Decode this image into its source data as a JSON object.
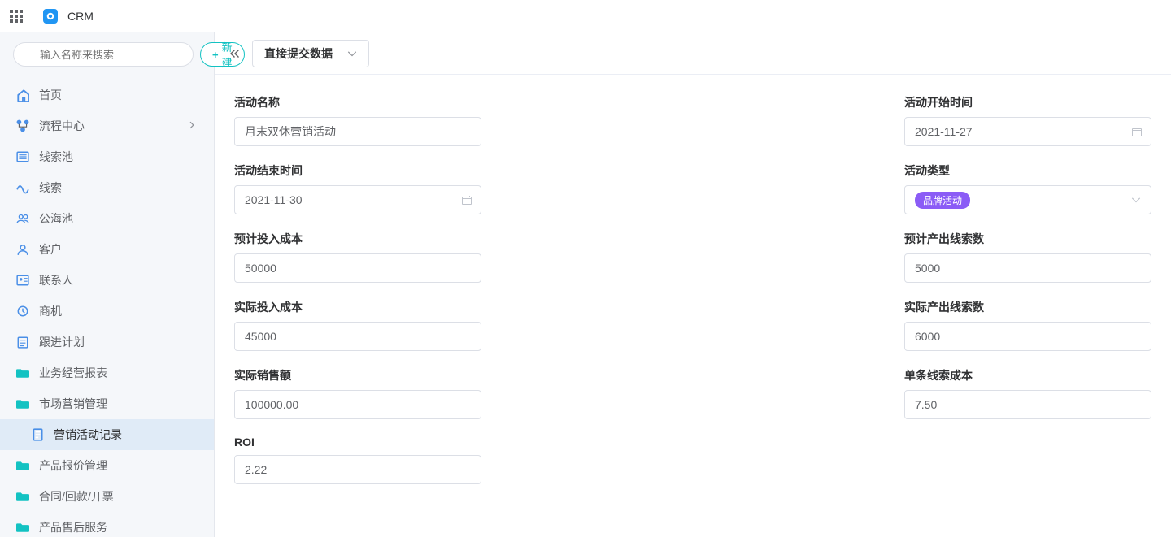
{
  "header": {
    "app_title": "CRM"
  },
  "sidebar": {
    "search_placeholder": "输入名称来搜索",
    "new_button": "新建",
    "items": [
      {
        "label": "首页",
        "icon": "home"
      },
      {
        "label": "流程中心",
        "icon": "flow",
        "has_chevron": true
      },
      {
        "label": "线索池",
        "icon": "pool"
      },
      {
        "label": "线索",
        "icon": "lead"
      },
      {
        "label": "公海池",
        "icon": "public-pool"
      },
      {
        "label": "客户",
        "icon": "customer"
      },
      {
        "label": "联系人",
        "icon": "contact"
      },
      {
        "label": "商机",
        "icon": "opportunity"
      },
      {
        "label": "跟进计划",
        "icon": "plan"
      },
      {
        "label": "业务经营报表",
        "icon": "folder"
      },
      {
        "label": "市场营销管理",
        "icon": "folder"
      },
      {
        "label": "营销活动记录",
        "icon": "doc",
        "sub": true,
        "active": true
      },
      {
        "label": "产品报价管理",
        "icon": "folder"
      },
      {
        "label": "合同/回款/开票",
        "icon": "folder"
      },
      {
        "label": "产品售后服务",
        "icon": "folder"
      }
    ]
  },
  "content": {
    "tab_label": "直接提交数据",
    "fields": {
      "activity_name": {
        "label": "活动名称",
        "value": "月末双休营销活动"
      },
      "start_time": {
        "label": "活动开始时间",
        "value": "2021-11-27"
      },
      "end_time": {
        "label": "活动结束时间",
        "value": "2021-11-30"
      },
      "activity_type": {
        "label": "活动类型",
        "value": "品牌活动"
      },
      "expected_cost": {
        "label": "预计投入成本",
        "value": "50000"
      },
      "expected_leads": {
        "label": "预计产出线索数",
        "value": "5000"
      },
      "actual_cost": {
        "label": "实际投入成本",
        "value": "45000"
      },
      "actual_leads": {
        "label": "实际产出线索数",
        "value": "6000"
      },
      "actual_sales": {
        "label": "实际销售额",
        "value": "100000.00"
      },
      "lead_cost": {
        "label": "单条线索成本",
        "value": "7.50"
      },
      "roi": {
        "label": "ROI",
        "value": "2.22"
      }
    }
  }
}
